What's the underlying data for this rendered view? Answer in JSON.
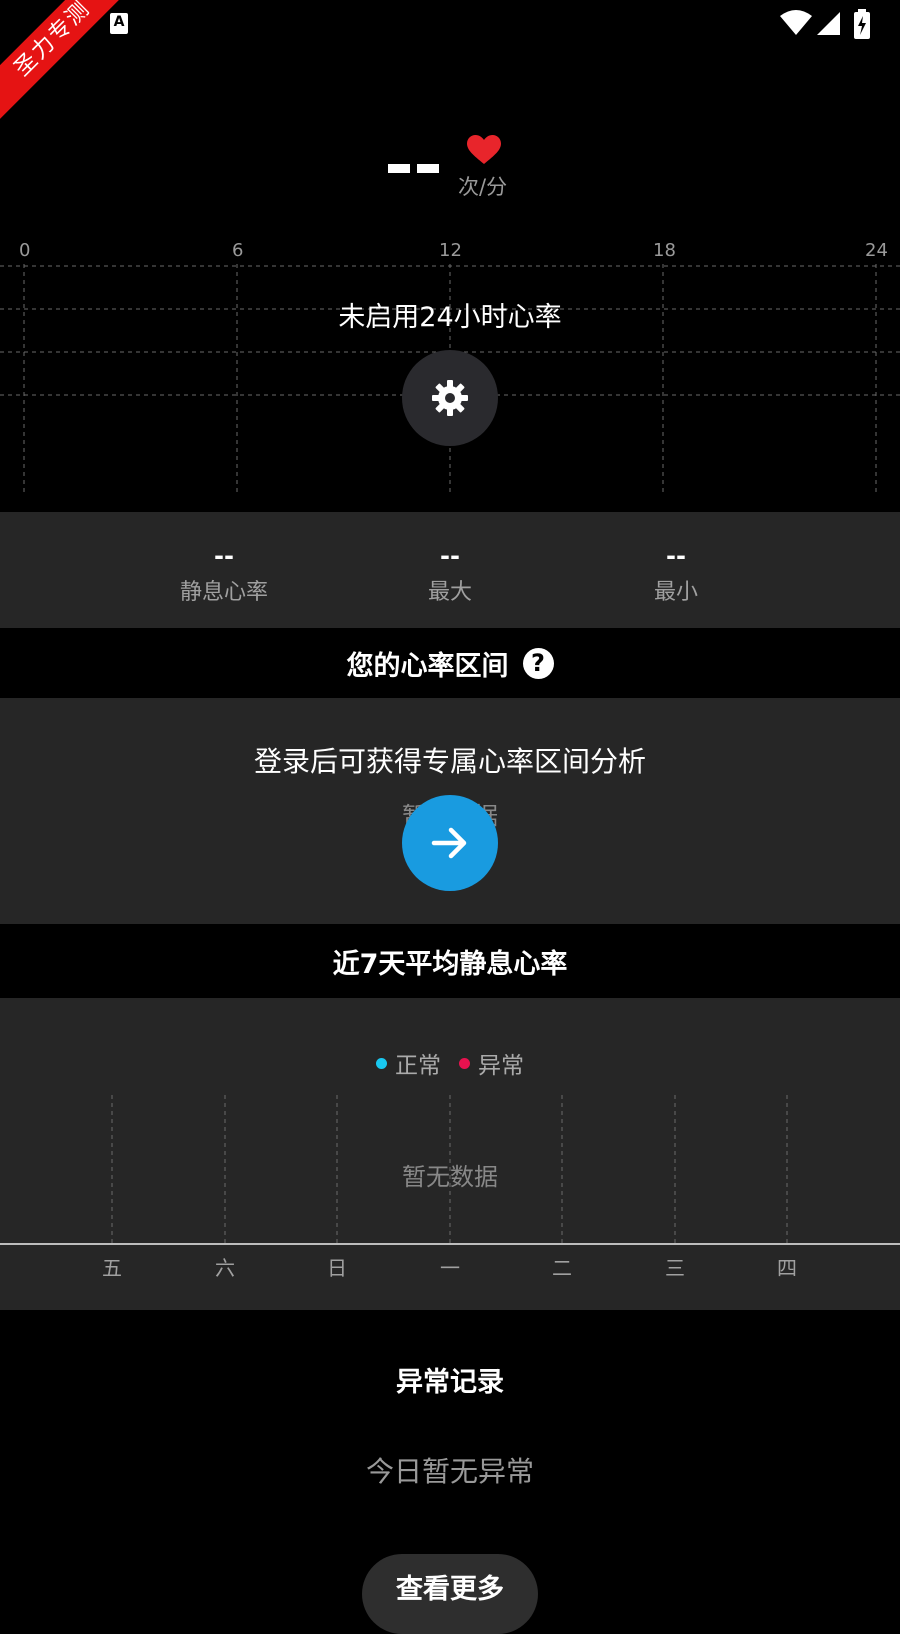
{
  "ribbon": {
    "text": "圣力专测"
  },
  "status_bar": {
    "icons": [
      "notification-dot-icon",
      "a-keyboard-icon",
      "wifi-icon",
      "signal-icon",
      "battery-charging-icon"
    ],
    "a_icon_label": "A"
  },
  "header": {
    "heart_rate_value": "--",
    "unit": "次/分",
    "icon": "heart-icon",
    "icon_color": "#e8252b"
  },
  "day_chart": {
    "x_ticks": [
      "0",
      "6",
      "12",
      "18",
      "24"
    ],
    "disabled_message": "未启用24小时心率",
    "settings_icon": "gear-icon"
  },
  "stats": [
    {
      "value": "--",
      "label": "静息心率"
    },
    {
      "value": "--",
      "label": "最大"
    },
    {
      "value": "--",
      "label": "最小"
    }
  ],
  "zones": {
    "title": "您的心率区间",
    "help_icon_label": "?",
    "login_message": "登录后可获得专属心率区间分析",
    "no_data": "暂无数据",
    "arrow_icon": "arrow-right-icon",
    "arrow_color": "#199be0"
  },
  "week": {
    "title": "近7天平均静息心率",
    "legend": [
      {
        "label": "正常",
        "color": "#19c8f0"
      },
      {
        "label": "异常",
        "color": "#e8124f"
      }
    ],
    "no_data": "暂无数据",
    "days": [
      "五",
      "六",
      "日",
      "一",
      "二",
      "三",
      "四"
    ]
  },
  "abnormal": {
    "title": "异常记录",
    "empty_message": "今日暂无异常",
    "more_button": "查看更多"
  }
}
